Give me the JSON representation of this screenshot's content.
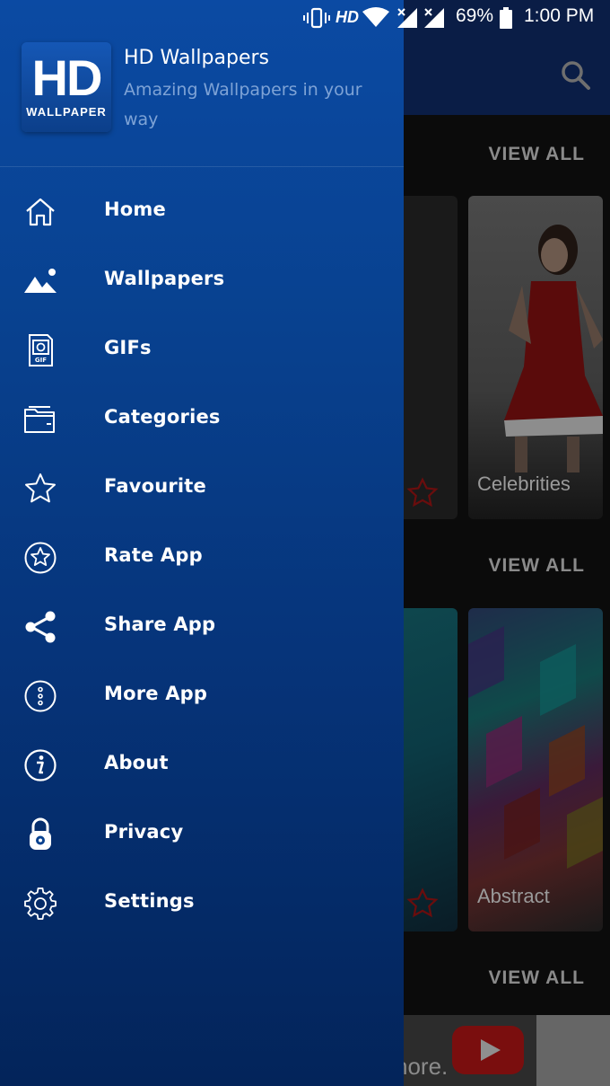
{
  "status_bar": {
    "hd_label": "HD",
    "battery": "69%",
    "time": "1:00 PM"
  },
  "drawer": {
    "app_name": "HD Wallpapers",
    "tagline": "Amazing Wallpapers in your way",
    "logo_text_main": "HD",
    "logo_text_sub": "WALLPAPER",
    "items": [
      {
        "label": "Home",
        "icon": "home-icon"
      },
      {
        "label": "Wallpapers",
        "icon": "image-icon"
      },
      {
        "label": "GIFs",
        "icon": "gif-icon"
      },
      {
        "label": "Categories",
        "icon": "folder-icon"
      },
      {
        "label": "Favourite",
        "icon": "star-icon"
      },
      {
        "label": "Rate App",
        "icon": "rate-icon"
      },
      {
        "label": "Share App",
        "icon": "share-icon"
      },
      {
        "label": "More App",
        "icon": "more-icon"
      },
      {
        "label": "About",
        "icon": "info-icon"
      },
      {
        "label": "Privacy",
        "icon": "lock-icon"
      },
      {
        "label": "Settings",
        "icon": "gear-icon"
      }
    ]
  },
  "background": {
    "view_all_label": "VIEW ALL",
    "cards": [
      {
        "label": "Celebrities"
      },
      {
        "label": "Abstract"
      }
    ],
    "ad_text": "nore."
  }
}
